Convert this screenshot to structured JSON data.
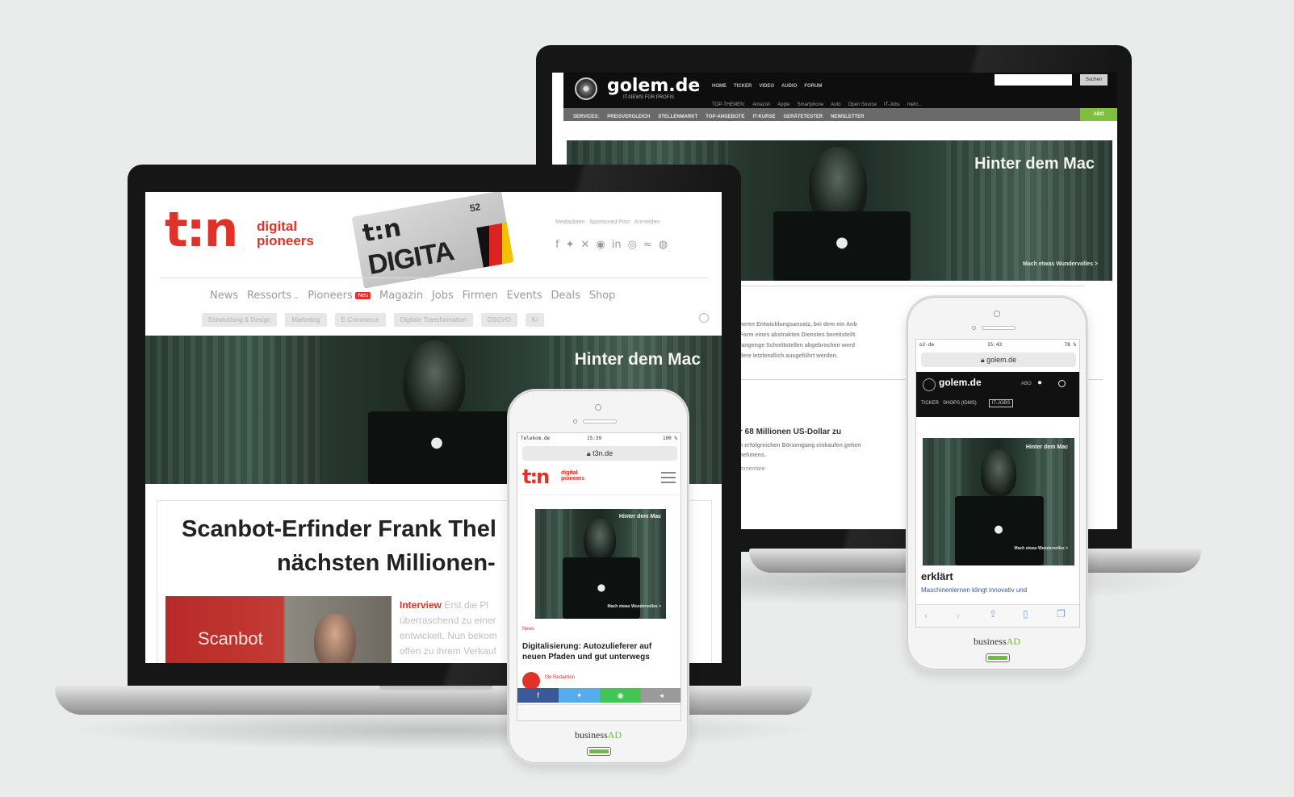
{
  "back_laptop": {
    "site": {
      "logo": "golem.de",
      "tagline": "IT-NEWS FÜR PROFIS",
      "nav_top": [
        "HOME",
        "TICKER",
        "VIDEO",
        "AUDIO",
        "FORUM"
      ],
      "nav_sub": [
        "TOP-THEMEN:",
        "Amazon",
        "Apple",
        "Smartphone",
        "Auto",
        "Open Source",
        "IT-Jobs",
        "mehr..."
      ],
      "nav_bar": [
        "SERVICES:",
        "PREISVERGLEICH",
        "STELLENMARKT",
        "TOP-ANGEBOTE",
        "IT-KURSE",
        "GERÄTETESTER",
        "NEWSLETTER"
      ],
      "nav_bar_right": "ABO",
      "search_button": "Suchen",
      "hero_headline": "Hinter dem Mac",
      "hero_cta": "Mach etwas Wundervolles >",
      "article_text": [
        "neren Entwicklungsansatz, bei dem ein Anb",
        "Form eines abstrakten Dienstes bereitstellt.",
        "fangenge Schnittstellen abgebrochen werd",
        "dere letztendlich ausgeführt werden."
      ],
      "article2_title": "r 68 Millionen US-Dollar zu",
      "article2_text": [
        "n erfolgreichen Börsengang einkaufen gehen",
        "nehmens."
      ],
      "article2_meta": "mmentare"
    }
  },
  "front_laptop": {
    "site": {
      "logo": "t:n",
      "logo_sub": [
        "digital",
        "pioneers"
      ],
      "magazine_cover": {
        "logo": "t:n",
        "issue": "52",
        "title": "DIGITA"
      },
      "top_links": [
        "Mediadaten",
        "Sponsored Post",
        "Anmelden"
      ],
      "social_icons": [
        "facebook-icon",
        "twitter-icon",
        "xing-icon",
        "whatsapp-icon",
        "linkedin-icon",
        "instagram-icon",
        "rss-icon",
        "podcast-icon"
      ],
      "nav": [
        "News",
        "Ressorts",
        "Pioneers",
        "Magazin",
        "Jobs",
        "Firmen",
        "Events",
        "Deals",
        "Shop"
      ],
      "nav_badge": "Neu",
      "chips": [
        "Entwicklung & Design",
        "Marketing",
        "E-Commerce",
        "Digitale Transformation",
        "DSGVO",
        "KI"
      ],
      "hero_headline": "Hinter dem Mac",
      "article_title": [
        "Scanbot-Erfinder Frank Thel",
        "nächsten Millionen-"
      ],
      "article_kicker": "Interview",
      "article_teaser": [
        "Erst die Pl",
        "überraschend zu einer",
        "entwickelt. Nun bekom",
        "offen zu ihrem Verkauf"
      ],
      "article_image_text": "Scanbot"
    }
  },
  "phone_left": {
    "status": {
      "carrier": "Telekom.de",
      "time": "15:39",
      "battery": "100 %"
    },
    "url": "t3n.de",
    "logo": "t:n",
    "logo_sub": [
      "digital",
      "pioneers"
    ],
    "ad_headline": "Hinter dem Mac",
    "ad_cta": "Mach etwas Wundervolles >",
    "category": "News",
    "headline": "Digitalisierung: Autozulieferer auf neuen Pfaden und gut unterwegs",
    "author": "t3n Redaktion",
    "brand": {
      "prefix": "business",
      "accent": "AD"
    }
  },
  "phone_right": {
    "status": {
      "carrier": "o2-de",
      "time": "15:43",
      "battery": "78 %"
    },
    "url": "golem.de",
    "logo": "golem.de",
    "abo": "ABO",
    "tabs": [
      "TICKER",
      "SHOPS (IDMS)",
      "IT-JOBS"
    ],
    "ad_headline": "Hinter dem Mac",
    "ad_cta": "Mach etwas Wundervolles >",
    "headline": "erklärt",
    "teaser": "Maschinenlernen klingt innovativ und",
    "brand": {
      "prefix": "business",
      "accent": "AD"
    }
  },
  "colors": {
    "t3n_red": "#e1322a",
    "golem_black": "#0e0e0e",
    "businessad_green": "#6cbf3c"
  }
}
